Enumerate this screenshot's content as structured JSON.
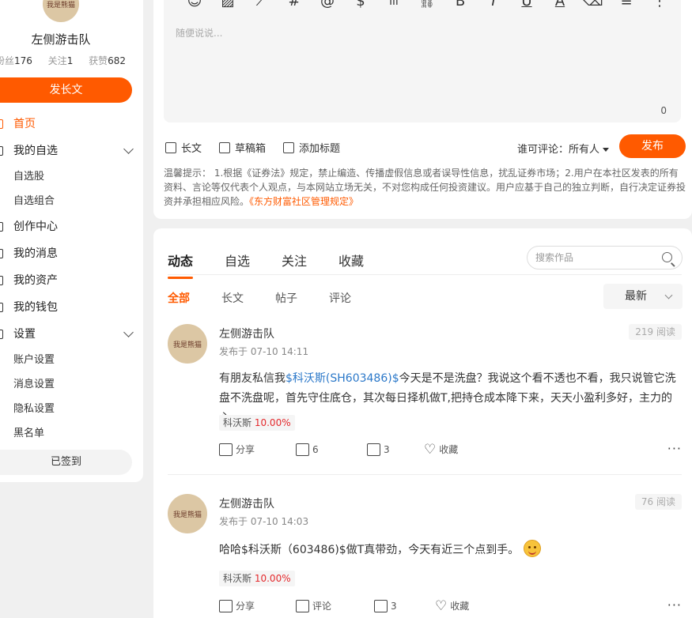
{
  "sidebar": {
    "avatar_text": "我是熊猫",
    "name": "左侧游击队",
    "stats": [
      {
        "label": "粉丝",
        "value": "176"
      },
      {
        "label": "关注",
        "value": "1"
      },
      {
        "label": "获赞",
        "value": "682"
      }
    ],
    "post_long_label": "发长文",
    "nav": {
      "home": "首页",
      "watchlist": "我的自选",
      "watch_stocks": "自选股",
      "watch_groups": "自选组合",
      "creator": "创作中心",
      "messages": "我的消息",
      "assets": "我的资产",
      "wallet": "我的钱包",
      "settings": "设置",
      "account": "账户设置",
      "msg_settings": "消息设置",
      "privacy": "隐私设置",
      "blacklist": "黑名单"
    },
    "signed_label": "已签到"
  },
  "editor": {
    "toolbar_icons": [
      "smile-icon",
      "image-icon",
      "chart-icon",
      "hash-icon",
      "at-icon",
      "dollar-icon",
      "bar-chart-icon",
      "link-icon",
      "bold-icon",
      "italic-icon",
      "underline-icon",
      "font-color-icon",
      "eraser-icon",
      "align-icon",
      "more-icon"
    ],
    "toolbar_glyphs": [
      "☺",
      "▨",
      "⟋",
      "#",
      "@",
      "$",
      "ılı",
      "🔗",
      "B",
      "I",
      "U",
      "A",
      "⌫",
      "≡",
      "⋮"
    ],
    "placeholder": "随便说说...",
    "counter": "0",
    "action_long": "长文",
    "action_drafts": "草稿箱",
    "action_title": "添加标题",
    "who_comment": "谁可评论：所有人",
    "publish_label": "发布",
    "tips_text": "温馨提示：  1.根据《证券法》规定，禁止编造、传播虚假信息或者误导性信息，扰乱证券市场；2.用户在本社区发表的所有资料、言论等仅代表个人观点，与本网站立场无关，不对您构成任何投资建议。用户应基于自己的独立判断，自行决定证券投资并承担相应风险。",
    "tips_link": "《东方财富社区管理规定》"
  },
  "feed": {
    "tabs": [
      "动态",
      "自选",
      "关注",
      "收藏"
    ],
    "search_placeholder": "搜索作品",
    "subtabs": [
      "全部",
      "长文",
      "帖子",
      "评论"
    ],
    "sort_label": "最新",
    "posts": [
      {
        "author": "左侧游击队",
        "time": "发布于 07-10 14:11",
        "views": "219 阅读",
        "text_before": "有朋友私信我",
        "stock_link": "$科沃斯(SH603486)$",
        "text_after": "今天是不是洗盘？我说这个看不透也不看，我只说管它洗盘不洗盘呢，首先守住底仓，其次每日择机做T,把持仓成本降下来，天天小盈利多好，主力的心...",
        "tag_name": "科沃斯",
        "tag_change": "10.00%",
        "share": "分享",
        "comments": "6",
        "likes": "3",
        "collect": "收藏"
      },
      {
        "author": "左侧游击队",
        "time": "发布于 07-10 14:03",
        "views": "76 阅读",
        "text": "哈哈$科沃斯（603486)$做T真带劲，今天有近三个点到手。",
        "tag_name": "科沃斯",
        "tag_change": "10.00%",
        "share": "分享",
        "comments": "评论",
        "likes": "3",
        "collect": "收藏"
      }
    ]
  }
}
